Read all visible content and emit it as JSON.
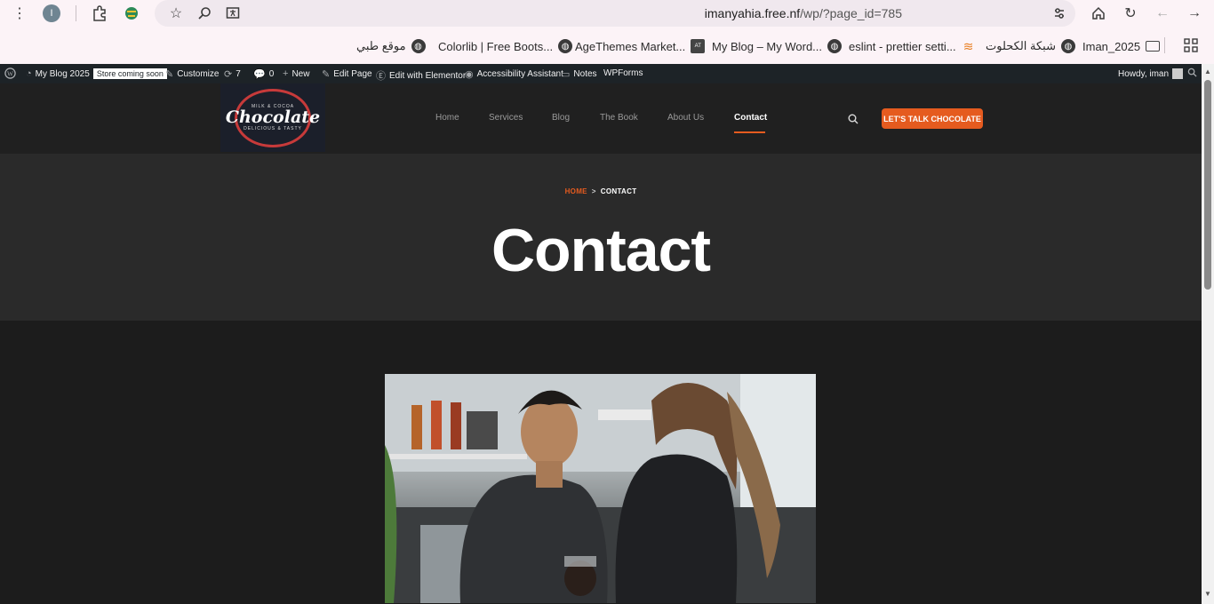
{
  "browser": {
    "profile_initial": "I",
    "url_host": "imanyahia.free.nf",
    "url_path": "/wp/?page_id=785"
  },
  "bookmarks": [
    {
      "label": "موقع طبي",
      "icon": "globe-icon"
    },
    {
      "label": "Colorlib | Free Boots...",
      "icon": "globe-icon"
    },
    {
      "label": "AgeThemes Market...",
      "icon": "agethemes-icon"
    },
    {
      "label": "My Blog – My Word...",
      "icon": "globe-icon"
    },
    {
      "label": "eslint - prettier setti...",
      "icon": "stackoverflow-icon"
    },
    {
      "label": "شبكة الكحلوت",
      "icon": "globe-icon"
    },
    {
      "label": "Iman_2025",
      "icon": "folder-icon"
    }
  ],
  "wpbar": {
    "site_name": "My Blog 2025",
    "store_badge": "Store coming soon",
    "customize": "Customize",
    "updates": "7",
    "comments": "0",
    "new": "New",
    "edit_page": "Edit Page",
    "edit_elementor": "Edit with Elementor",
    "accessibility": "Accessibility Assistant",
    "notes": "Notes",
    "wpforms": "WPForms",
    "howdy": "Howdy, iman"
  },
  "site": {
    "logo_top": "MILK & COCOA",
    "logo_word": "Chocolate",
    "logo_bottom": "DELICIOUS & TASTY",
    "nav": [
      "Home",
      "Services",
      "Blog",
      "The Book",
      "About Us",
      "Contact"
    ],
    "cta": "LET'S TALK CHOCOLATE",
    "accent": "#e55b1f"
  },
  "hero": {
    "crumb_home": "HOME",
    "crumb_sep": ">",
    "crumb_current": "CONTACT",
    "title": "Contact"
  }
}
